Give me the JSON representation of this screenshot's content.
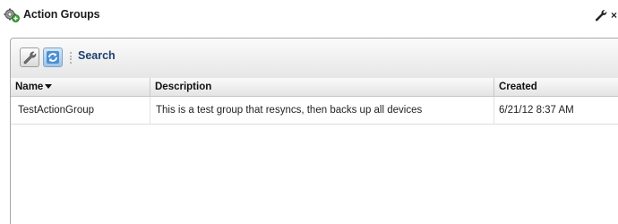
{
  "header": {
    "title": "Action Groups",
    "icon": "gear-plus-icon",
    "tools": {
      "wrench_icon": "wrench-icon",
      "close_icon": "close-icon"
    }
  },
  "toolbar": {
    "settings_icon": "wrench-icon",
    "refresh_icon": "refresh-icon",
    "search_label": "Search"
  },
  "table": {
    "columns": [
      "Name",
      "Description",
      "Created"
    ],
    "sort_column": "Name",
    "sort_direction": "descending",
    "rows": [
      {
        "name": "TestActionGroup",
        "description": "This is a test group that resyncs, then backs up all devices",
        "created": "6/21/12 8:37 AM"
      }
    ]
  },
  "colors": {
    "link": "#1f3f72",
    "border": "#a8a8a8",
    "header_bg": "#e4e4e4"
  }
}
